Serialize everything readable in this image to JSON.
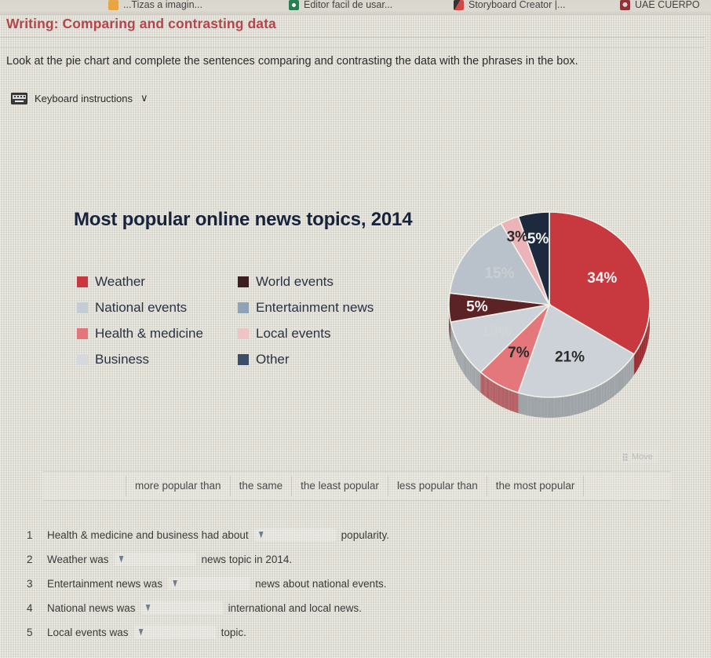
{
  "browser": {
    "tabs": [
      {
        "title": "...Tizas a imagin...",
        "favicon": "orange-square-favicon"
      },
      {
        "title": "Editor facil de usar...",
        "favicon": "green-check-favicon"
      },
      {
        "title": "Storyboard Creator |...",
        "favicon": "red-black-favicon"
      },
      {
        "title": "UAE CUERPO",
        "favicon": "maroon-shield-favicon"
      }
    ]
  },
  "page": {
    "heading": "Writing: Comparing and contrasting data",
    "instructions": "Look at the pie chart and complete the sentences comparing and contrasting the data with the phrases in the box.",
    "keyboard_instructions_label": "Keyboard instructions",
    "keyboard_chevron": "∨",
    "move_handle_label": "Move"
  },
  "chart_data": {
    "type": "pie",
    "title": "Most popular online news topics, 2014",
    "categories": [
      "Weather",
      "National events",
      "Health & medicine",
      "Business",
      "World events",
      "Entertainment news",
      "Local events",
      "Other"
    ],
    "values": [
      34,
      21,
      7,
      10,
      5,
      15,
      3,
      5
    ],
    "labels": [
      "34%",
      "21%",
      "7%",
      "10%",
      "5%",
      "15%",
      "3%",
      "5%"
    ],
    "colors": [
      "#c8393f",
      "#ccd2d8",
      "#e4777c",
      "#ccd2d8",
      "#5c2327",
      "#b9c2cb",
      "#eab4b8",
      "#1d2a3d"
    ],
    "legend_position": "left",
    "legend": [
      {
        "label": "Weather",
        "color": "#c8393f"
      },
      {
        "label": "World events",
        "color": "#3d1f22"
      },
      {
        "label": "National events",
        "color": "#c6ccd4"
      },
      {
        "label": "Entertainment news",
        "color": "#8fa3b8"
      },
      {
        "label": "Health & medicine",
        "color": "#e2767b"
      },
      {
        "label": "Local events",
        "color": "#f0c3c6"
      },
      {
        "label": "Business",
        "color": "#d5d9dd"
      },
      {
        "label": "Other",
        "color": "#3c4f68"
      }
    ],
    "xlabel": "",
    "ylabel": "",
    "grid": false
  },
  "word_bank": {
    "chips": [
      "more popular than",
      "the same",
      "the least popular",
      "less popular than",
      "the most popular"
    ]
  },
  "sentences": [
    {
      "num": "1",
      "pre": "Health & medicine and business had about",
      "post": "popularity."
    },
    {
      "num": "2",
      "pre": "Weather was",
      "post": "news topic in 2014."
    },
    {
      "num": "3",
      "pre": "Entertainment news was",
      "post": "news about national events."
    },
    {
      "num": "4",
      "pre": "National news was",
      "post": "international and local news."
    },
    {
      "num": "5",
      "pre": "Local events was",
      "post": "topic."
    }
  ]
}
